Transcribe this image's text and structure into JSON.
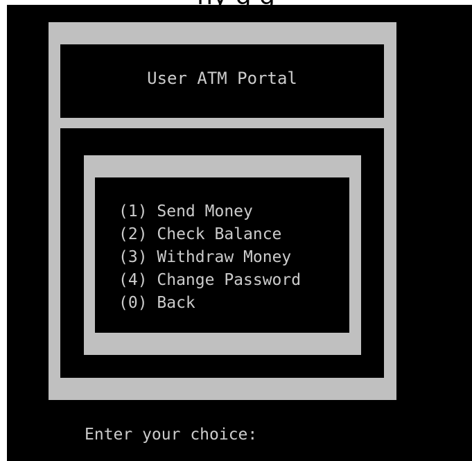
{
  "window": {
    "top_cut_text": "ny g                           g"
  },
  "header": {
    "title": "User ATM Portal"
  },
  "menu": {
    "items": [
      {
        "label": "(1) Send Money"
      },
      {
        "label": "(2) Check Balance"
      },
      {
        "label": "(3) Withdraw Money"
      },
      {
        "label": "(4) Change Password"
      },
      {
        "label": "(0) Back"
      }
    ]
  },
  "prompt": {
    "label": "Enter your choice:"
  },
  "colors": {
    "background": "#000000",
    "frame": "#c0c0c0",
    "text": "#cccccc"
  }
}
